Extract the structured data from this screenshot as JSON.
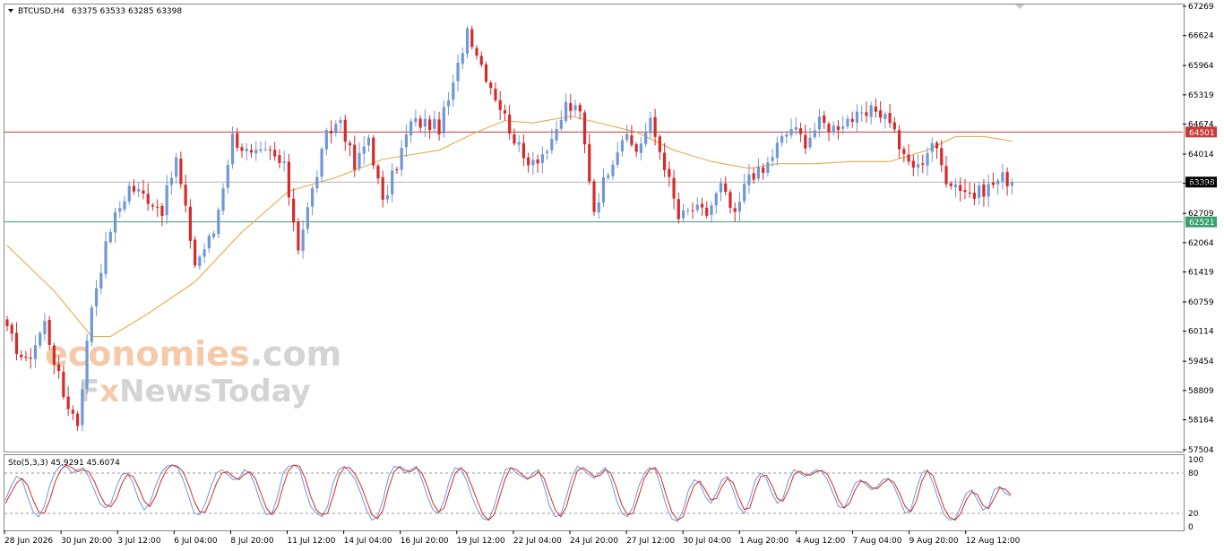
{
  "header": {
    "symbol": "BTCUSD,H4",
    "ohlc": "63375 63533 63285 63398"
  },
  "indicator": {
    "label": "Sto(5,3,3) 45.9291 45.6074",
    "levels": [
      "100",
      "80",
      "20",
      "0"
    ]
  },
  "watermark": {
    "line1_part1": "economies",
    "line1_part2": ".com",
    "line2_part1": "F",
    "line2_part2": "x",
    "line2_part3": "NewsToday"
  },
  "colors": {
    "bull": "#6f98d6",
    "bear": "#d42b2b",
    "ma": "#e4a43a",
    "resistance": "#c93a3a",
    "support": "#3aa06b",
    "current": "#b5b5b5",
    "stoch_k": "#6f98d6",
    "stoch_d": "#d42b2b",
    "watermark_orange": "#f6c9a8",
    "watermark_gray": "#d4d4d4"
  },
  "chart_data": {
    "type": "candlestick",
    "symbol": "BTCUSD",
    "timeframe": "H4",
    "price_axis_ticks": [
      67269,
      66624,
      65964,
      65319,
      64674,
      64014,
      63369,
      62709,
      62064,
      61419,
      60759,
      60114,
      59454,
      58809,
      58164,
      57504
    ],
    "ylim": [
      57504,
      67269
    ],
    "time_labels": [
      "28 Jun 2026",
      "30 Jun 20:00",
      "3 Jul 12:00",
      "6 Jul 04:00",
      "8 Jul 20:00",
      "11 Jul 12:00",
      "14 Jul 04:00",
      "16 Jul 20:00",
      "19 Jul 12:00",
      "22 Jul 04:00",
      "24 Jul 20:00",
      "27 Jul 12:00",
      "30 Jul 04:00",
      "1 Aug 20:00",
      "4 Aug 12:00",
      "7 Aug 04:00",
      "9 Aug 20:00",
      "12 Aug 12:00"
    ],
    "horizontal_lines": [
      {
        "label": "64501",
        "value": 64501,
        "role": "resistance"
      },
      {
        "label": "63398",
        "value": 63398,
        "role": "current"
      },
      {
        "label": "62521",
        "value": 62521,
        "role": "support"
      }
    ],
    "close_path": [
      [
        0,
        60100
      ],
      [
        4,
        59400
      ],
      [
        8,
        60300
      ],
      [
        12,
        58700
      ],
      [
        15,
        58100
      ],
      [
        18,
        60700
      ],
      [
        22,
        62400
      ],
      [
        26,
        63300
      ],
      [
        30,
        63050
      ],
      [
        33,
        62800
      ],
      [
        36,
        63900
      ],
      [
        40,
        61600
      ],
      [
        44,
        62300
      ],
      [
        48,
        64400
      ],
      [
        52,
        63950
      ],
      [
        56,
        64050
      ],
      [
        59,
        63700
      ],
      [
        62,
        62000
      ],
      [
        65,
        63200
      ],
      [
        68,
        64400
      ],
      [
        71,
        64800
      ],
      [
        74,
        63700
      ],
      [
        77,
        64400
      ],
      [
        80,
        62900
      ],
      [
        83,
        63800
      ],
      [
        86,
        64700
      ],
      [
        89,
        64700
      ],
      [
        92,
        64600
      ],
      [
        95,
        65500
      ],
      [
        98,
        66800
      ],
      [
        101,
        66000
      ],
      [
        104,
        65300
      ],
      [
        107,
        64600
      ],
      [
        110,
        63900
      ],
      [
        113,
        63950
      ],
      [
        116,
        64200
      ],
      [
        119,
        65100
      ],
      [
        122,
        64900
      ],
      [
        125,
        62800
      ],
      [
        128,
        63700
      ],
      [
        131,
        64400
      ],
      [
        134,
        64100
      ],
      [
        137,
        64700
      ],
      [
        140,
        63800
      ],
      [
        143,
        62600
      ],
      [
        146,
        62800
      ],
      [
        149,
        62700
      ],
      [
        152,
        63300
      ],
      [
        155,
        62600
      ],
      [
        158,
        63600
      ],
      [
        161,
        63600
      ],
      [
        164,
        64200
      ],
      [
        167,
        64600
      ],
      [
        170,
        64300
      ],
      [
        173,
        64700
      ],
      [
        176,
        64600
      ],
      [
        179,
        64800
      ],
      [
        182,
        64800
      ],
      [
        185,
        65000
      ],
      [
        188,
        64800
      ],
      [
        191,
        63900
      ],
      [
        194,
        63700
      ],
      [
        197,
        64300
      ],
      [
        200,
        63500
      ],
      [
        203,
        63300
      ],
      [
        206,
        63100
      ],
      [
        209,
        63300
      ],
      [
        212,
        63500
      ],
      [
        214,
        63398
      ]
    ],
    "moving_average": [
      [
        0,
        62000
      ],
      [
        10,
        61000
      ],
      [
        18,
        60000
      ],
      [
        22,
        60000
      ],
      [
        30,
        60500
      ],
      [
        40,
        61200
      ],
      [
        50,
        62300
      ],
      [
        60,
        63200
      ],
      [
        70,
        63500
      ],
      [
        80,
        63900
      ],
      [
        92,
        64100
      ],
      [
        100,
        64500
      ],
      [
        106,
        64750
      ],
      [
        112,
        64700
      ],
      [
        120,
        64850
      ],
      [
        126,
        64700
      ],
      [
        134,
        64500
      ],
      [
        142,
        64100
      ],
      [
        150,
        63850
      ],
      [
        158,
        63700
      ],
      [
        164,
        63800
      ],
      [
        172,
        63800
      ],
      [
        180,
        63850
      ],
      [
        188,
        63850
      ],
      [
        196,
        64100
      ],
      [
        202,
        64400
      ],
      [
        208,
        64400
      ],
      [
        214,
        64300
      ]
    ],
    "stochastic": {
      "name": "Sto(5,3,3)",
      "k": 45.9291,
      "d": 45.6074,
      "levels": [
        20,
        80
      ],
      "range": [
        0,
        100
      ],
      "k_values": [
        40,
        60,
        75,
        70,
        45,
        22,
        15,
        30,
        62,
        82,
        92,
        90,
        80,
        85,
        88,
        75,
        55,
        35,
        28,
        35,
        60,
        78,
        80,
        65,
        40,
        25,
        35,
        60,
        80,
        90,
        92,
        88,
        70,
        45,
        20,
        18,
        35,
        60,
        80,
        85,
        78,
        70,
        72,
        85,
        80,
        60,
        35,
        18,
        20,
        45,
        80,
        90,
        92,
        85,
        55,
        30,
        20,
        15,
        30,
        65,
        85,
        90,
        82,
        70,
        50,
        25,
        10,
        15,
        40,
        75,
        90,
        88,
        80,
        85,
        90,
        70,
        45,
        25,
        20,
        40,
        70,
        88,
        85,
        70,
        45,
        25,
        12,
        10,
        30,
        60,
        85,
        88,
        80,
        75,
        70,
        80,
        85,
        60,
        30,
        15,
        18,
        45,
        75,
        90,
        85,
        78,
        72,
        80,
        88,
        70,
        40,
        20,
        15,
        30,
        60,
        80,
        88,
        85,
        60,
        30,
        12,
        8,
        25,
        55,
        70,
        65,
        45,
        35,
        50,
        70,
        75,
        55,
        30,
        20,
        40,
        70,
        80,
        72,
        50,
        35,
        42,
        70,
        85,
        80,
        75,
        80,
        85,
        82,
        70,
        50,
        30,
        28,
        45,
        65,
        70,
        62,
        55,
        60,
        70,
        72,
        60,
        40,
        20,
        25,
        55,
        80,
        85,
        65,
        40,
        18,
        10,
        12,
        30,
        50,
        55,
        40,
        25,
        30,
        55,
        60,
        50,
        46
      ],
      "d_values": [
        35,
        50,
        65,
        72,
        62,
        40,
        22,
        20,
        40,
        68,
        85,
        92,
        88,
        82,
        85,
        82,
        68,
        48,
        33,
        30,
        42,
        65,
        78,
        75,
        58,
        38,
        30,
        45,
        68,
        85,
        92,
        90,
        82,
        62,
        38,
        22,
        22,
        42,
        65,
        80,
        82,
        75,
        70,
        78,
        82,
        72,
        50,
        28,
        18,
        30,
        60,
        84,
        92,
        90,
        72,
        45,
        25,
        18,
        20,
        45,
        75,
        88,
        88,
        78,
        62,
        40,
        18,
        12,
        25,
        58,
        82,
        90,
        84,
        82,
        88,
        80,
        60,
        35,
        22,
        28,
        55,
        80,
        88,
        80,
        60,
        38,
        18,
        10,
        18,
        45,
        72,
        88,
        85,
        78,
        72,
        75,
        82,
        72,
        48,
        25,
        15,
        30,
        60,
        84,
        88,
        82,
        75,
        76,
        85,
        80,
        58,
        32,
        18,
        20,
        45,
        72,
        85,
        88,
        74,
        46,
        22,
        10,
        15,
        40,
        62,
        68,
        55,
        40,
        42,
        60,
        72,
        66,
        44,
        26,
        28,
        55,
        75,
        77,
        62,
        42,
        38,
        55,
        78,
        83,
        78,
        77,
        82,
        84,
        78,
        62,
        40,
        28,
        35,
        55,
        68,
        66,
        58,
        57,
        65,
        71,
        66,
        50,
        30,
        22,
        38,
        68,
        83,
        76,
        52,
        28,
        14,
        10,
        20,
        40,
        52,
        48,
        32,
        27,
        42,
        58,
        56,
        48
      ]
    }
  }
}
